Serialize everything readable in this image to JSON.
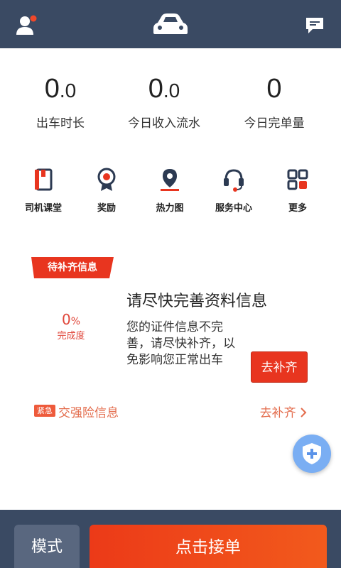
{
  "icons": {
    "user": "user-icon",
    "logo": "car-logo-icon",
    "message": "message-icon",
    "classroom": "book-icon",
    "reward": "medal-icon",
    "heatmap": "location-pin-icon",
    "service": "headset-icon",
    "more": "grid-icon",
    "shield": "shield-plus-icon"
  },
  "colors": {
    "topbar": "#3a4a63",
    "accent_red": "#e8351f",
    "link_red": "#e36b4b",
    "fab_blue": "#7aaef3"
  },
  "stats": [
    {
      "value_int": "0",
      "value_dec": ".0",
      "label": "出车时长"
    },
    {
      "value_int": "0",
      "value_dec": ".0",
      "label": "今日收入流水"
    },
    {
      "value_int": "0",
      "value_dec": "",
      "label": "今日完单量"
    }
  ],
  "menu": [
    {
      "label": "司机课堂"
    },
    {
      "label": "奖励"
    },
    {
      "label": "热力图"
    },
    {
      "label": "服务中心"
    },
    {
      "label": "更多"
    }
  ],
  "card": {
    "tag": "待补齐信息",
    "progress_value": "0",
    "progress_unit": "%",
    "progress_label": "完成度",
    "title": "请尽快完善资料信息",
    "description": "您的证件信息不完善，请尽快补齐，以免影响您正常出车",
    "button": "去补齐"
  },
  "urgent": {
    "badge": "紧急",
    "text": "交强险信息",
    "link": "去补齐"
  },
  "bottom": {
    "mode": "模式",
    "accept": "点击接单"
  }
}
